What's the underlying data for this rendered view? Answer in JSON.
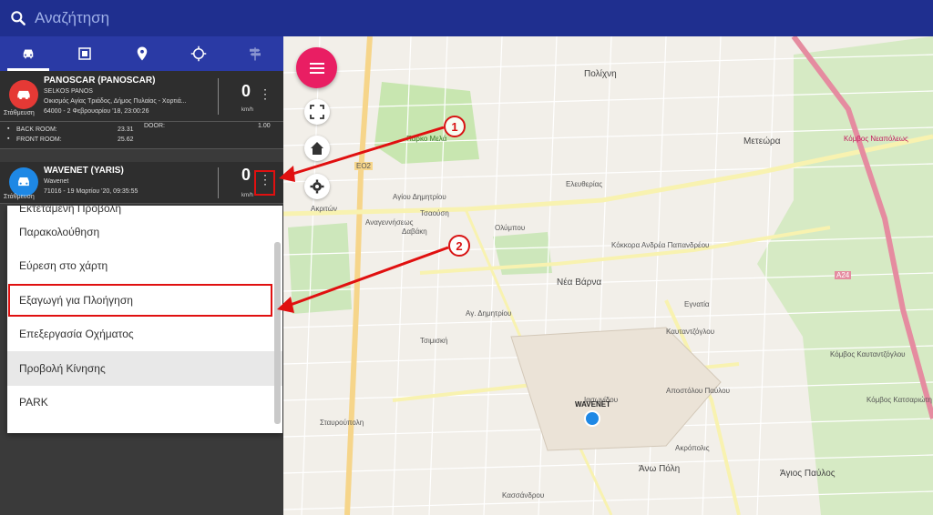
{
  "search": {
    "placeholder": "Αναζήτηση"
  },
  "tabs": [
    {
      "icon": "car-icon"
    },
    {
      "icon": "geofence-icon"
    },
    {
      "icon": "place-marker-icon"
    },
    {
      "icon": "crosshair-icon"
    },
    {
      "icon": "signpost-icon"
    }
  ],
  "vehicles": [
    {
      "name": "PANOSCAR (PANOSCAR)",
      "owner": "SELKOS PANOS",
      "location": "Οικισμός Αγίας Τριάδος, Δήμος Πυλαίας - Χορτιά...",
      "datetime": "64000 - 2 Φεβρουαρίου '18, 23:00:26",
      "status": "Στάθμευση",
      "speed": "0",
      "unit": "km/h",
      "status_color": "#e53935",
      "sensors": [
        {
          "label": "BACK ROOM:",
          "value": "23.31"
        },
        {
          "label": "FRONT ROOM:",
          "value": "25.62"
        },
        {
          "label": "DOOR:",
          "value": "1.00"
        }
      ]
    },
    {
      "name": "WAVENET (YARIS)",
      "owner": "Wavenet",
      "datetime": "71016 - 19 Μαρτίου '20, 09:35:55",
      "status": "Στάθμευση",
      "speed": "0",
      "unit": "km/h",
      "status_color": "#1e88e5"
    }
  ],
  "menu": {
    "items": [
      "Εκτεταμένη Προβολή",
      "Παρακολούθηση",
      "Εύρεση στο χάρτη",
      "Εξαγωγή για Πλοήγηση",
      "Επεξεργασία Οχήματος",
      "Προβολή Κίνησης",
      "PARK"
    ]
  },
  "map": {
    "marker_label": "WAVENET",
    "labels": [
      "Πολίχνη",
      "Μετεώρα",
      "Κόμβος Νεαπόλεως",
      "Αγίου Δημητρίου",
      "Κόκκορα Ανδρέα Παπανδρέου",
      "Πάρκο Μελά",
      "Αναγεννήσεως",
      "Νέα Βάρνα",
      "Άνω Πόλη",
      "Άγιος Παύλος",
      "Καυταντζόγλου",
      "Κόμβος Κατσαριώτη",
      "Εγνατία",
      "Ακριτών",
      "Δαβάκη",
      "Ελευθερίας",
      "Σταυρούπολη",
      "Τσιμισκή",
      "Αγ. Δημητρίου",
      "A24",
      "EO2",
      "Τσαούση",
      "Ολύμπου",
      "Κασσάνδρου",
      "Ιασωνίδου",
      "Αποστόλου Παύλου",
      "Ακρόπολις",
      "Κόμβος Καυταντζόγλου"
    ]
  },
  "callouts": [
    "1",
    "2"
  ],
  "colors": {
    "topbar": "#1f2f8f",
    "tabs": "#2a3aa5",
    "fab": "#e91e63",
    "highlight": "#e01010"
  }
}
